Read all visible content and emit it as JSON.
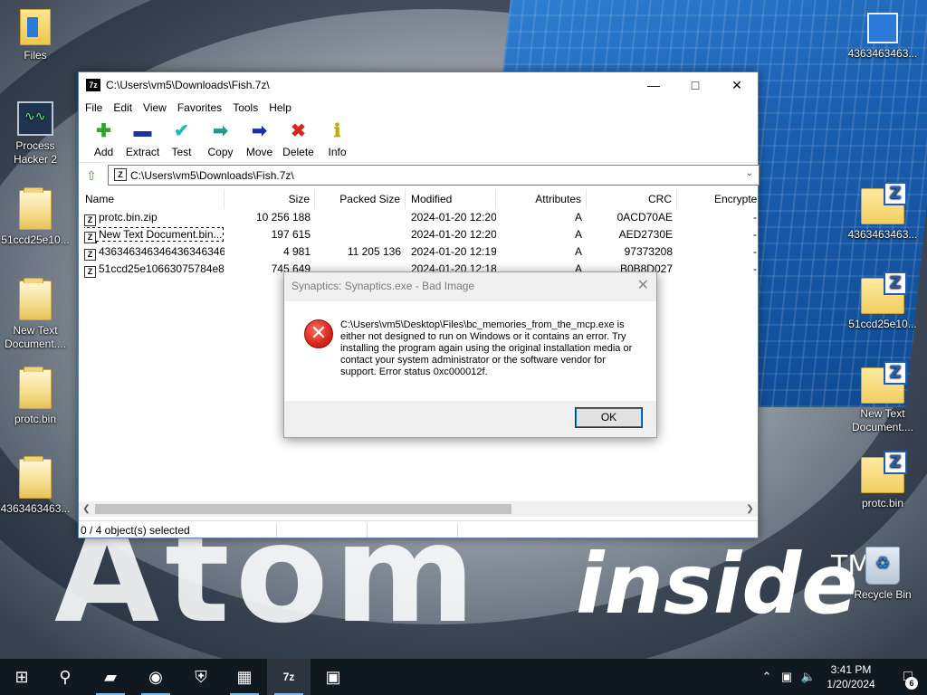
{
  "desktop": {
    "left_icons": [
      {
        "label": "Files",
        "icon": "files-icon"
      },
      {
        "label": "Process Hacker 2",
        "icon": "process-hacker-icon"
      },
      {
        "label": "51ccd25e10...",
        "icon": "folder-icon"
      },
      {
        "label": "New Text Document....",
        "icon": "folder-icon"
      },
      {
        "label": "protc.bin",
        "icon": "folder-icon"
      },
      {
        "label": "4363463463...",
        "icon": "folder-icon"
      }
    ],
    "right_icons": [
      {
        "label": "4363463463...",
        "icon": "shortcut-icon"
      },
      {
        "label": "4363463463...",
        "icon": "zip-folder-icon"
      },
      {
        "label": "51ccd25e10...",
        "icon": "zip-folder-icon"
      },
      {
        "label": "New Text Document....",
        "icon": "zip-folder-icon"
      },
      {
        "label": "protc.bin",
        "icon": "zip-folder-icon"
      },
      {
        "label": "Recycle Bin",
        "icon": "recycle-bin-icon"
      }
    ],
    "wallpaper": {
      "word1": "Atom",
      "word2": "inside",
      "tm": "TM"
    }
  },
  "window": {
    "title": "C:\\Users\\vm5\\Downloads\\Fish.7z\\",
    "app_icon_text": "7z",
    "menu": [
      "File",
      "Edit",
      "View",
      "Favorites",
      "Tools",
      "Help"
    ],
    "toolbar": [
      {
        "label": "Add",
        "icon": "plus-icon",
        "glyph": "✚",
        "color": "#2fa52f"
      },
      {
        "label": "Extract",
        "icon": "minus-icon",
        "glyph": "▬",
        "color": "#1c2fa8"
      },
      {
        "label": "Test",
        "icon": "check-icon",
        "glyph": "✔",
        "color": "#22b8b8"
      },
      {
        "label": "Copy",
        "icon": "copy-arrow-icon",
        "glyph": "➡",
        "color": "#1f9a8a"
      },
      {
        "label": "Move",
        "icon": "move-arrow-icon",
        "glyph": "➡",
        "color": "#1c2fa8"
      },
      {
        "label": "Delete",
        "icon": "delete-x-icon",
        "glyph": "✖",
        "color": "#d9251c"
      },
      {
        "label": "Info",
        "icon": "info-icon",
        "glyph": "ℹ",
        "color": "#c2a800"
      }
    ],
    "address": "C:\\Users\\vm5\\Downloads\\Fish.7z\\",
    "columns": [
      "Name",
      "Size",
      "Packed Size",
      "Modified",
      "Attributes",
      "CRC",
      "Encrypte"
    ],
    "files": [
      {
        "name": "protc.bin.zip",
        "size": "10 256 188",
        "packed": "",
        "modified": "2024-01-20 12:20",
        "attr": "A",
        "crc": "0ACD70AE",
        "enc": "-"
      },
      {
        "name": "New Text Document.bin...",
        "size": "197 615",
        "packed": "",
        "modified": "2024-01-20 12:20",
        "attr": "A",
        "crc": "AED2730E",
        "enc": "-"
      },
      {
        "name": "4363463463464363463463...",
        "size": "4 981",
        "packed": "11 205 136",
        "modified": "2024-01-20 12:19",
        "attr": "A",
        "crc": "97373208",
        "enc": "-"
      },
      {
        "name": "51ccd25e10663075784e8...",
        "size": "745 649",
        "packed": "",
        "modified": "2024-01-20 12:18",
        "attr": "A",
        "crc": "B0B8D027",
        "enc": "-"
      }
    ],
    "status": "0 / 4 object(s) selected"
  },
  "dialog": {
    "title": "Synaptics: Synaptics.exe - Bad Image",
    "message": "C:\\Users\\vm5\\Desktop\\Files\\bc_memories_from_the_mcp.exe is either not designed to run on Windows or it contains an error. Try installing the program again using the original installation media or contact your system administrator or the software vendor for support. Error status 0xc000012f.",
    "ok_label": "OK",
    "error_icon_glyph": "✕"
  },
  "taskbar": {
    "time": "3:41 PM",
    "date": "1/20/2024",
    "notification_count": "6",
    "items": [
      {
        "name": "start-icon",
        "glyph": "⊞"
      },
      {
        "name": "search-icon",
        "glyph": "⚲"
      },
      {
        "name": "file-explorer-icon",
        "glyph": "▰"
      },
      {
        "name": "chrome-icon",
        "glyph": "◉"
      },
      {
        "name": "security-shield-icon",
        "glyph": "⛨"
      },
      {
        "name": "task-manager-icon",
        "glyph": "▦"
      },
      {
        "name": "7zip-taskbar-icon",
        "glyph": "7z"
      },
      {
        "name": "window-app-icon",
        "glyph": "▣"
      }
    ]
  }
}
